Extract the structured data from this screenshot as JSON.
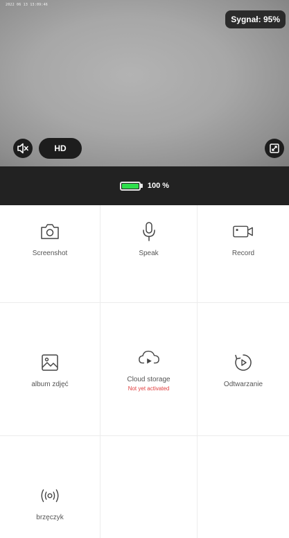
{
  "preview": {
    "timestamp": "2022 06 13 13:09:46",
    "signal": "Sygnał: 95%",
    "quality_label": "HD",
    "mute_icon": "speaker-muted-icon",
    "fullscreen_icon": "fullscreen-icon"
  },
  "battery": {
    "level_text": "100 %",
    "level": 100,
    "fill_color": "#2ee04c"
  },
  "actions": [
    {
      "id": "screenshot",
      "label": "Screenshot",
      "icon": "camera-icon"
    },
    {
      "id": "speak",
      "label": "Speak",
      "icon": "microphone-icon"
    },
    {
      "id": "record",
      "label": "Record",
      "icon": "video-camera-icon"
    },
    {
      "id": "album",
      "label": "album zdjęć",
      "icon": "image-icon"
    },
    {
      "id": "cloud",
      "label": "Cloud storage",
      "sublabel": "Not yet activated",
      "icon": "cloud-play-icon"
    },
    {
      "id": "playback",
      "label": "Odtwarzanie",
      "icon": "playback-icon"
    },
    {
      "id": "buzzer",
      "label": "brzęczyk",
      "icon": "buzzer-icon"
    }
  ],
  "colors": {
    "warning": "#e03b3b",
    "icon": "#444444"
  }
}
